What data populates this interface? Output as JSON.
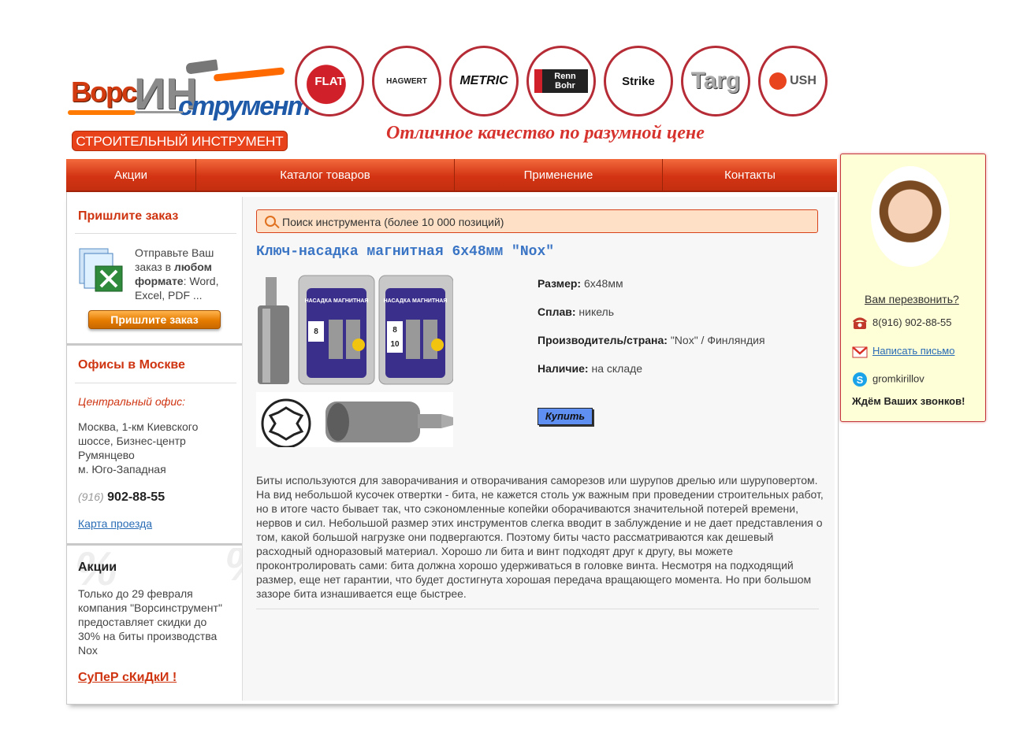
{
  "header": {
    "logo_parts": [
      "Ворс",
      "ИН",
      "струмент"
    ],
    "logo_tagline": "СТРОИТЕЛЬНЫЙ ИНСТРУМЕНТ",
    "brands": [
      "FLAT",
      "HAGWERT",
      "METRIC",
      "Renn Bohr",
      "Strike",
      "Targ",
      "USH"
    ],
    "slogan": "Отличное качество по разумной цене"
  },
  "nav": {
    "items": [
      "Акции",
      "Каталог товаров",
      "Применение",
      "Контакты"
    ]
  },
  "sidebar": {
    "order": {
      "title": "Пришлите заказ",
      "text_prefix": "Отправьте Ваш заказ в ",
      "text_bold": "любом формате",
      "text_suffix": ": Word, Excel, PDF ...",
      "button": "Пришлите заказ"
    },
    "offices": {
      "title": "Офисы в Москве",
      "subtitle": "Центральный офис:",
      "address": "Москва, 1-км Киевского шоссе, Бизнес-центр Румянцево",
      "metro": "м. Юго-Западная",
      "phone_code": "(916)",
      "phone_number": "902-88-55",
      "map_link": "Карта проезда"
    },
    "promo": {
      "title": "Акции",
      "text": "Только до 29 февраля компания \"Ворсинструмент\" предоставляет скидки до 30% на биты производства Nox",
      "link": "СуПеР сКиДкИ !"
    }
  },
  "search": {
    "placeholder": "Поиск инструмента (более 10 000 позиций)"
  },
  "product": {
    "title": "Ключ-насадка магнитная 6х48мм \"Nox\"",
    "package_label": "НАСАДКА МАГНИТНАЯ",
    "package_sizes": [
      "8",
      "10"
    ],
    "props": [
      {
        "label": "Размер:",
        "value": "6х48мм"
      },
      {
        "label": "Сплав:",
        "value": "никель"
      },
      {
        "label": "Производитель/страна:",
        "value": "\"Nox\" / Финляндия"
      },
      {
        "label": "Наличие:",
        "value": "на складе"
      }
    ],
    "buy_label": "Купить",
    "description": "Биты используются для заворачивания и отворачивания саморезов или шурупов дрелью или шуруповертом. На вид небольшой кусочек отвертки - бита, не кажется столь уж важным при проведении строительных работ, но в итоге часто бывает так, что сэкономленные копейки оборачиваются значительной потерей времени, нервов и сил. Небольшой размер этих инструментов слегка вводит в заблуждение и не дает представления о том, какой большой нагрузке они подвергаются. Поэтому биты часто рассматриваются как дешевый расходный одноразовый материал. Хорошо ли бита и винт подходят друг к другу, вы можете проконтролировать сами: бита должна хорошо удерживаться в головке винта. Несмотря на подходящий размер, еще нет гарантии, что будет достигнута хорошая передача вращающего момента. Но при большом зазоре бита изнашивается еще быстрее."
  },
  "widget": {
    "callback_link": "Вам перезвонить?",
    "phone": "8(916) 902-88-55",
    "email_link": "Написать письмо",
    "skype": "gromkirillov",
    "footer": "Ждём Ваших звонков!"
  },
  "colors": {
    "accent": "#d33413",
    "link": "#2a6cb5",
    "title_blue": "#3a74c4",
    "widget_bg": "#fefed7"
  }
}
